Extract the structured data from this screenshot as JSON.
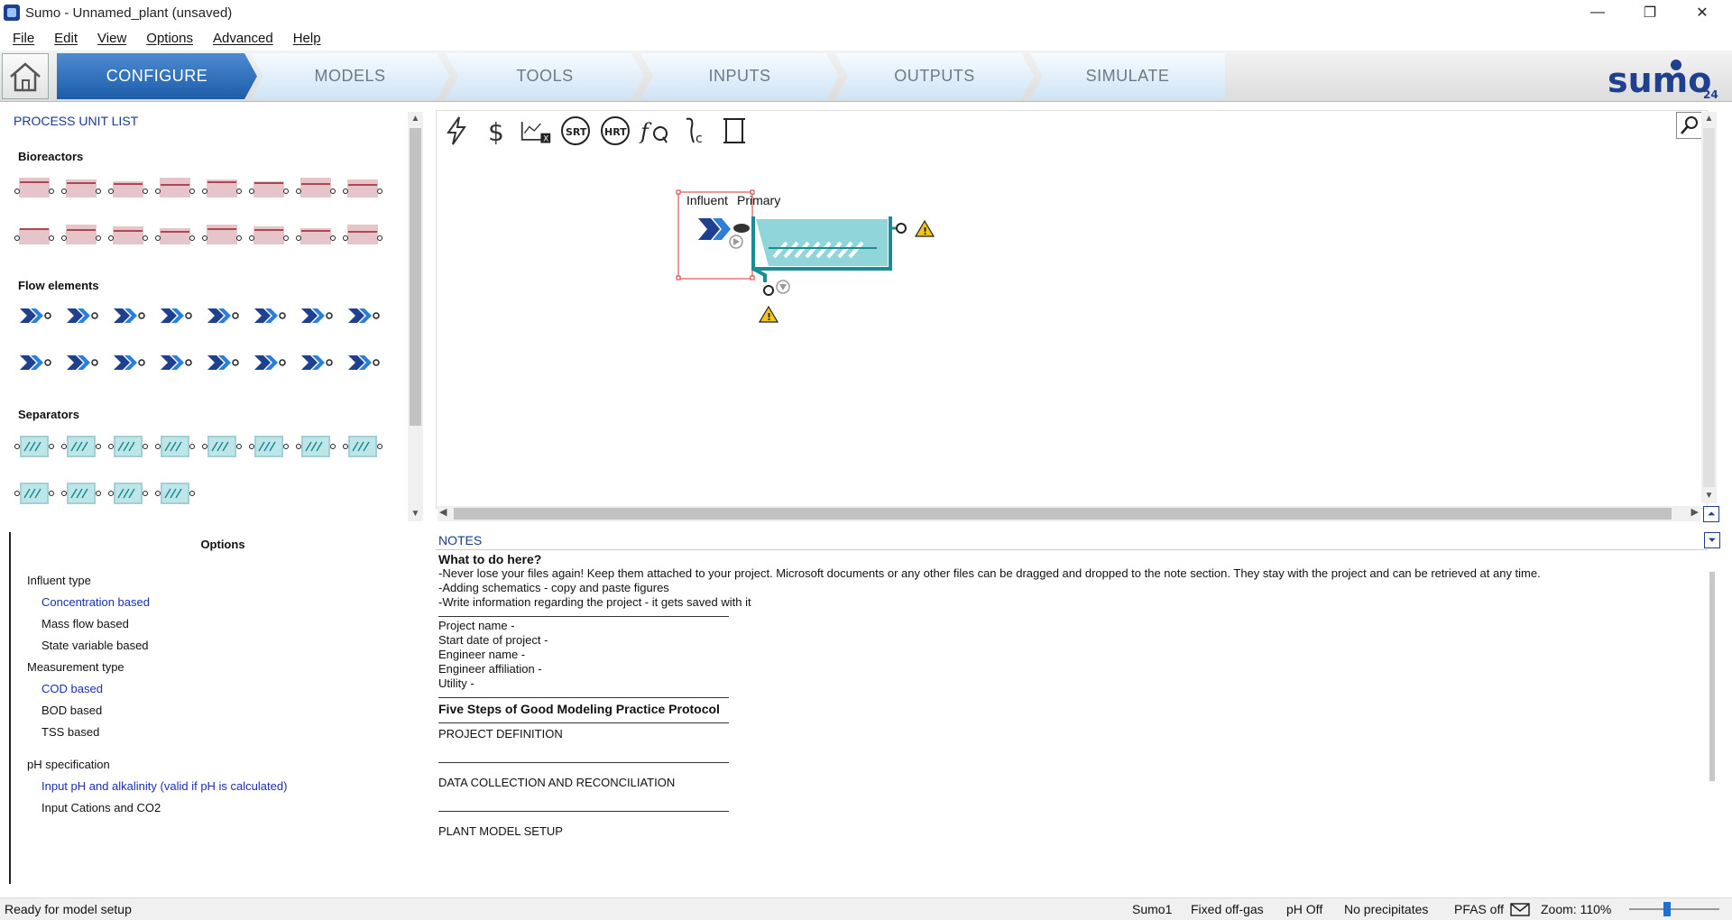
{
  "window": {
    "title": "Sumo - Unnamed_plant (unsaved)",
    "controls": [
      "—",
      "❐",
      "✕"
    ]
  },
  "menu": [
    "File",
    "Edit",
    "View",
    "Options",
    "Advanced",
    "Help"
  ],
  "tabs": [
    {
      "label": "CONFIGURE",
      "active": true
    },
    {
      "label": "MODELS",
      "active": false
    },
    {
      "label": "TOOLS",
      "active": false
    },
    {
      "label": "INPUTS",
      "active": false
    },
    {
      "label": "OUTPUTS",
      "active": false
    },
    {
      "label": "SIMULATE",
      "active": false
    }
  ],
  "logo": {
    "text": "sumo",
    "superscript": "24"
  },
  "process_unit_list": {
    "title": "PROCESS UNIT LIST",
    "categories": [
      {
        "name": "Bioreactors",
        "count": 16,
        "color": "#9b1c2c"
      },
      {
        "name": "Flow elements",
        "count": 16,
        "color": "#1f3f8f"
      },
      {
        "name": "Separators",
        "count": 12,
        "color": "#1a8c96"
      }
    ]
  },
  "canvas": {
    "toolbar_icons": [
      "lightning-icon",
      "dollar-icon",
      "chart-clear-icon",
      "srt-icon",
      "hrt-icon",
      "fq-icon",
      "calibration-icon",
      "scroll-icon"
    ],
    "srt_label": "SRT",
    "hrt_label": "HRT",
    "influent_label": "Influent",
    "primary_label": "Primary"
  },
  "options": {
    "title": "Options",
    "influent_type_label": "Influent type",
    "influent_type": [
      "Concentration based",
      "Mass flow based",
      "State variable based"
    ],
    "measurement_type_label": "Measurement type",
    "measurement_type": [
      "COD based",
      "BOD based",
      "TSS based"
    ],
    "ph_label": "pH specification",
    "ph": [
      "Input pH and alkalinity (valid if pH is calculated)",
      "Input Cations and CO2"
    ]
  },
  "notes": {
    "title": "NOTES",
    "heading": "What to do here?",
    "lines": [
      "-Never lose your files again! Keep them attached to your project. Microsoft documents or any other files can be dragged and dropped to the note section. They stay with the project and can be retrieved at any time.",
      "-Adding schematics - copy and paste figures",
      "-Write information regarding the project - it gets saved with it"
    ],
    "fields": [
      "Project name -",
      "Start date of project -",
      "Engineer name -",
      "Engineer affiliation -",
      "Utility -"
    ],
    "protocol_title": "Five Steps of Good Modeling Practice Protocol",
    "steps": [
      "PROJECT DEFINITION",
      "DATA COLLECTION AND RECONCILIATION",
      "PLANT MODEL SETUP"
    ]
  },
  "status": {
    "message": "Ready for model setup",
    "model": "Sumo1",
    "offgas": "Fixed off-gas",
    "ph": "pH Off",
    "precipitates": "No precipitates",
    "pfas": "PFAS off",
    "zoom": "Zoom: 110%"
  },
  "colors": {
    "accent": "#1d5ca8",
    "bioreactor": "#9b1c2c",
    "flow": "#1f3f8f",
    "separator": "#1a8c96"
  }
}
